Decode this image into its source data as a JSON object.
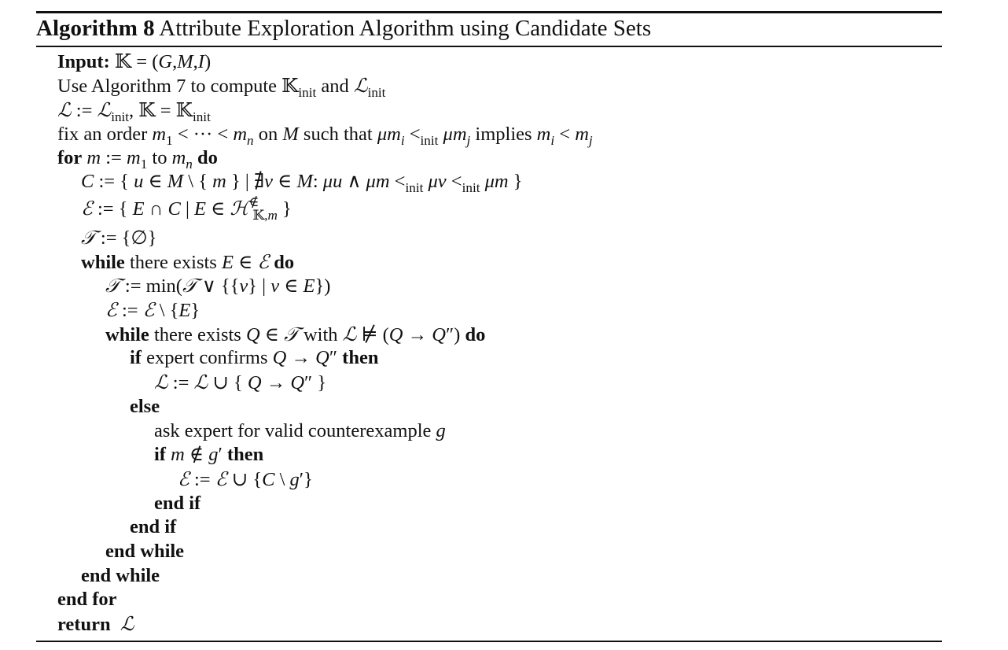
{
  "caption": {
    "label": "Algorithm 8",
    "title": "Attribute Exploration Algorithm using Candidate Sets"
  },
  "keywords": {
    "input": "Input:",
    "for": "for",
    "to": "to",
    "do": "do",
    "while": "while",
    "if": "if",
    "then": "then",
    "else": "else",
    "end_if": "end if",
    "end_while": "end while",
    "end_for": "end for",
    "return": "return"
  },
  "text": {
    "use_algorithm": "Use Algorithm 7 to compute",
    "and": "and",
    "fix_order": "fix an order",
    "on": "on",
    "such_that": "such that",
    "implies": "implies",
    "there_exists": "there exists",
    "with": "with",
    "expert_confirms": "expert confirms",
    "ask_expert": "ask expert for valid counterexample",
    "init": "init"
  }
}
